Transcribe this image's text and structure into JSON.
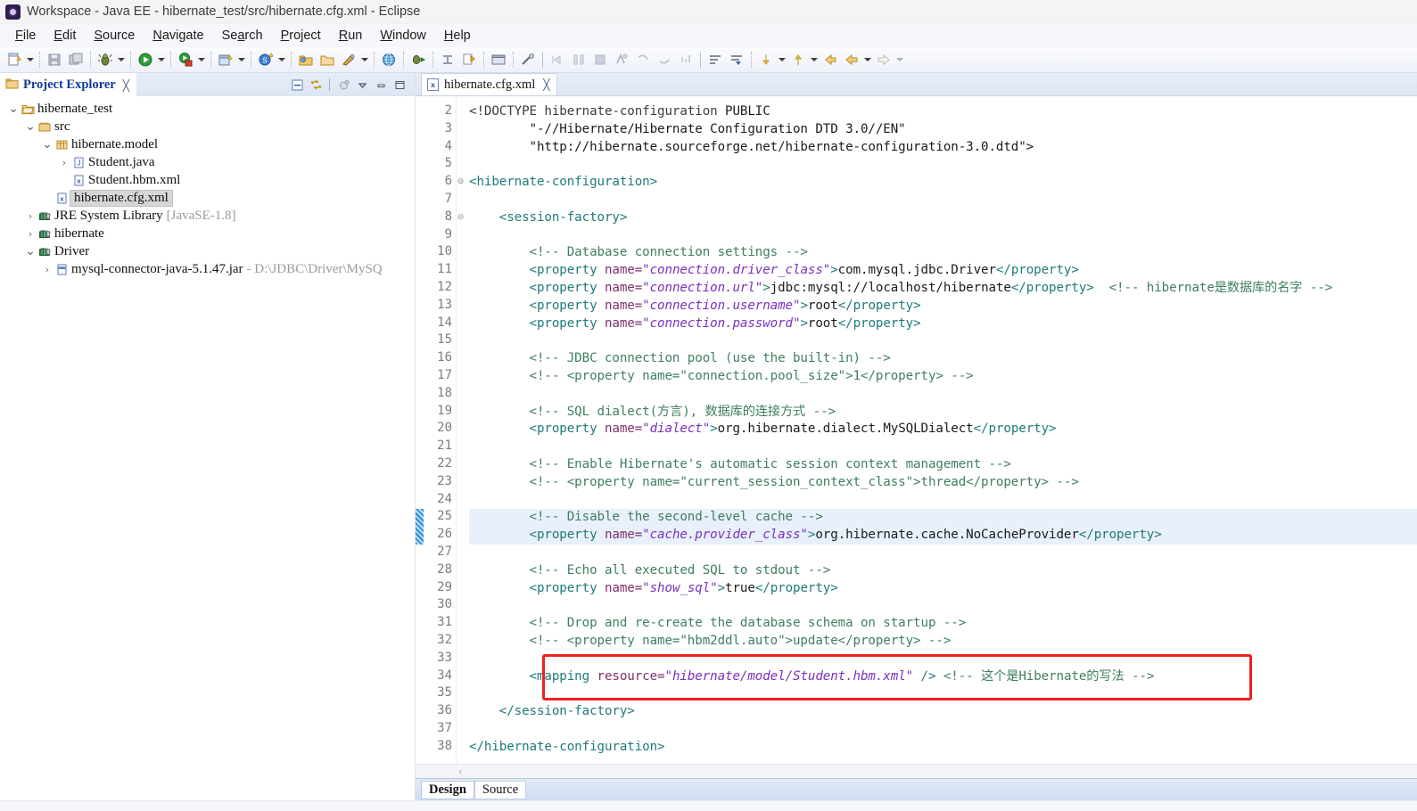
{
  "window": {
    "title": "Workspace - Java EE - hibernate_test/src/hibernate.cfg.xml - Eclipse",
    "app_icon": "eclipse-icon"
  },
  "menubar": {
    "items": [
      {
        "label": "File",
        "mnemonic": "F"
      },
      {
        "label": "Edit",
        "mnemonic": "E"
      },
      {
        "label": "Source",
        "mnemonic": "S"
      },
      {
        "label": "Navigate",
        "mnemonic": "N"
      },
      {
        "label": "Search",
        "mnemonic": "a"
      },
      {
        "label": "Project",
        "mnemonic": "P"
      },
      {
        "label": "Run",
        "mnemonic": "R"
      },
      {
        "label": "Window",
        "mnemonic": "W"
      },
      {
        "label": "Help",
        "mnemonic": "H"
      }
    ]
  },
  "toolbar": {
    "buttons": [
      {
        "name": "new-wizard-icon",
        "tip": "New"
      },
      {
        "name": "save-icon",
        "tip": "Save"
      },
      {
        "name": "save-all-icon",
        "tip": "Save All"
      },
      {
        "name": "debug-icon",
        "tip": "Debug"
      },
      {
        "name": "run-icon",
        "tip": "Run"
      },
      {
        "name": "run-server-icon",
        "tip": "Run on Server"
      },
      {
        "name": "new-java-project-icon",
        "tip": "New Java Project"
      },
      {
        "name": "new-servlet-icon",
        "tip": "New Servlet"
      },
      {
        "name": "open-type-icon",
        "tip": "Open Type"
      },
      {
        "name": "open-task-icon",
        "tip": "Open Task"
      },
      {
        "name": "external-tools-icon",
        "tip": "External Tools"
      },
      {
        "name": "web-browser-icon",
        "tip": "Web Browser"
      },
      {
        "name": "debug-perspective-icon",
        "tip": "Debug Perspective"
      },
      {
        "name": "terminate-icon",
        "tip": "Terminate"
      },
      {
        "name": "relaunch-icon",
        "tip": "Relaunch"
      },
      {
        "name": "console-icon",
        "tip": "Console"
      },
      {
        "name": "skip-breakpoints-icon",
        "tip": "Skip All Breakpoints"
      },
      {
        "name": "step-into-icon",
        "tip": "Step Into"
      },
      {
        "name": "step-over-icon",
        "tip": "Step Over"
      },
      {
        "name": "step-return-icon",
        "tip": "Step Return"
      },
      {
        "name": "drop-to-frame-icon",
        "tip": "Drop to Frame"
      },
      {
        "name": "use-step-filters-icon",
        "tip": "Use Step Filters"
      },
      {
        "name": "next-annotation-icon",
        "tip": "Next Annotation"
      },
      {
        "name": "prev-annotation-icon",
        "tip": "Previous Annotation"
      },
      {
        "name": "last-edit-icon",
        "tip": "Last Edit Location"
      },
      {
        "name": "back-icon",
        "tip": "Back"
      },
      {
        "name": "forward-icon",
        "tip": "Forward"
      }
    ]
  },
  "explorer": {
    "title": "Project Explorer",
    "close_glyph": "╳",
    "tools": [
      {
        "name": "collapse-all-icon"
      },
      {
        "name": "link-with-editor-icon"
      },
      {
        "name": "focus-on-active-task-icon"
      },
      {
        "name": "view-menu-icon"
      },
      {
        "name": "minimize-view-icon"
      },
      {
        "name": "maximize-view-icon"
      }
    ],
    "tree": [
      {
        "indent": 0,
        "twist": "v",
        "icon": "project-icon",
        "label": "hibernate_test",
        "extra": "",
        "selected": false
      },
      {
        "indent": 1,
        "twist": "v",
        "icon": "source-folder-icon",
        "label": "src",
        "extra": "",
        "selected": false
      },
      {
        "indent": 2,
        "twist": "v",
        "icon": "package-icon",
        "label": "hibernate.model",
        "extra": "",
        "selected": false
      },
      {
        "indent": 3,
        "twist": ">",
        "icon": "java-file-icon",
        "label": "Student.java",
        "extra": "",
        "selected": false
      },
      {
        "indent": 3,
        "twist": "",
        "icon": "xml-file-icon",
        "label": "Student.hbm.xml",
        "extra": "",
        "selected": false
      },
      {
        "indent": 2,
        "twist": "",
        "icon": "xml-file-icon",
        "label": "hibernate.cfg.xml",
        "extra": "",
        "selected": true
      },
      {
        "indent": 1,
        "twist": ">",
        "icon": "library-icon",
        "label": "JRE System Library",
        "extra": "[JavaSE-1.8]",
        "selected": false
      },
      {
        "indent": 1,
        "twist": ">",
        "icon": "library-icon",
        "label": "hibernate",
        "extra": "",
        "selected": false
      },
      {
        "indent": 1,
        "twist": "v",
        "icon": "library-icon",
        "label": "Driver",
        "extra": "",
        "selected": false
      },
      {
        "indent": 2,
        "twist": ">",
        "icon": "jar-icon",
        "label": "mysql-connector-java-5.1.47.jar",
        "extra": "- D:\\JDBC\\Driver\\MySQ",
        "selected": false
      }
    ]
  },
  "editor": {
    "tab": {
      "label": "hibernate.cfg.xml",
      "badge": "x",
      "close_glyph": "╳",
      "dirty": false
    },
    "first_line_number": 2,
    "highlighted_lines": [
      25,
      26
    ],
    "change_bar_lines": [
      25,
      26
    ],
    "fold_lines": [
      6,
      8
    ],
    "red_box_line": 34,
    "bottom_tabs": [
      {
        "label": "Design",
        "active": true
      },
      {
        "label": "Source",
        "active": false
      }
    ],
    "lines": [
      {
        "n": 2,
        "indent": 0,
        "parts": [
          {
            "t": "dt",
            "s": "<!DOCTYPE hibernate-configuration "
          },
          {
            "t": "txt",
            "s": "PUBLIC"
          }
        ]
      },
      {
        "n": 3,
        "indent": 0,
        "parts": [
          {
            "t": "txt",
            "s": "        \"-//Hibernate/Hibernate Configuration DTD 3.0//EN\""
          }
        ]
      },
      {
        "n": 4,
        "indent": 0,
        "parts": [
          {
            "t": "txt",
            "s": "        \"http://hibernate.sourceforge.net/hibernate-configuration-3.0.dtd\">"
          }
        ]
      },
      {
        "n": 5,
        "indent": 0,
        "parts": []
      },
      {
        "n": 6,
        "indent": 0,
        "parts": [
          {
            "t": "tg",
            "s": "<hibernate-configuration>"
          }
        ]
      },
      {
        "n": 7,
        "indent": 0,
        "parts": []
      },
      {
        "n": 8,
        "indent": 0,
        "parts": [
          {
            "t": "tg",
            "s": "    <session-factory>"
          }
        ]
      },
      {
        "n": 9,
        "indent": 0,
        "parts": []
      },
      {
        "n": 10,
        "indent": 0,
        "parts": [
          {
            "t": "cm",
            "s": "        <!-- Database connection settings -->"
          }
        ]
      },
      {
        "n": 11,
        "indent": 0,
        "parts": [
          {
            "t": "tg",
            "s": "        <property "
          },
          {
            "t": "at",
            "s": "name="
          },
          {
            "t": "av",
            "s": "\"connection.driver_class\""
          },
          {
            "t": "tg",
            "s": ">"
          },
          {
            "t": "txt",
            "s": "com.mysql.jdbc.Driver"
          },
          {
            "t": "tg",
            "s": "</property>"
          }
        ]
      },
      {
        "n": 12,
        "indent": 0,
        "parts": [
          {
            "t": "tg",
            "s": "        <property "
          },
          {
            "t": "at",
            "s": "name="
          },
          {
            "t": "av",
            "s": "\"connection.url\""
          },
          {
            "t": "tg",
            "s": ">"
          },
          {
            "t": "txt",
            "s": "jdbc:mysql://localhost/hibernate"
          },
          {
            "t": "tg",
            "s": "</property>"
          },
          {
            "t": "cm",
            "s": "  <!-- "
          },
          {
            "t": "cmz",
            "s": "hibernate是数据库的名字"
          },
          {
            "t": "cm",
            "s": " -->"
          }
        ]
      },
      {
        "n": 13,
        "indent": 0,
        "parts": [
          {
            "t": "tg",
            "s": "        <property "
          },
          {
            "t": "at",
            "s": "name="
          },
          {
            "t": "av",
            "s": "\"connection.username\""
          },
          {
            "t": "tg",
            "s": ">"
          },
          {
            "t": "txt",
            "s": "root"
          },
          {
            "t": "tg",
            "s": "</property>"
          }
        ]
      },
      {
        "n": 14,
        "indent": 0,
        "parts": [
          {
            "t": "tg",
            "s": "        <property "
          },
          {
            "t": "at",
            "s": "name="
          },
          {
            "t": "av",
            "s": "\"connection.password\""
          },
          {
            "t": "tg",
            "s": ">"
          },
          {
            "t": "txt",
            "s": "root"
          },
          {
            "t": "tg",
            "s": "</property>"
          }
        ]
      },
      {
        "n": 15,
        "indent": 0,
        "parts": []
      },
      {
        "n": 16,
        "indent": 0,
        "parts": [
          {
            "t": "cm",
            "s": "        <!-- JDBC connection pool (use the built-in) -->"
          }
        ]
      },
      {
        "n": 17,
        "indent": 0,
        "parts": [
          {
            "t": "cm",
            "s": "        <!-- <property name=\"connection.pool_size\">1</property> -->"
          }
        ]
      },
      {
        "n": 18,
        "indent": 0,
        "parts": []
      },
      {
        "n": 19,
        "indent": 0,
        "parts": [
          {
            "t": "cm",
            "s": "        <!-- SQL dialect(方言), 数据库的连接方式 -->"
          }
        ]
      },
      {
        "n": 20,
        "indent": 0,
        "parts": [
          {
            "t": "tg",
            "s": "        <property "
          },
          {
            "t": "at",
            "s": "name="
          },
          {
            "t": "av",
            "s": "\"dialect\""
          },
          {
            "t": "tg",
            "s": ">"
          },
          {
            "t": "txt",
            "s": "org.hibernate.dialect.MySQLDialect"
          },
          {
            "t": "tg",
            "s": "</property>"
          }
        ]
      },
      {
        "n": 21,
        "indent": 0,
        "parts": []
      },
      {
        "n": 22,
        "indent": 0,
        "parts": [
          {
            "t": "cm",
            "s": "        <!-- Enable Hibernate's automatic session context management -->"
          }
        ]
      },
      {
        "n": 23,
        "indent": 0,
        "parts": [
          {
            "t": "cm",
            "s": "        <!-- <property name=\"current_session_context_class\">thread</property> -->"
          }
        ]
      },
      {
        "n": 24,
        "indent": 0,
        "parts": []
      },
      {
        "n": 25,
        "indent": 0,
        "parts": [
          {
            "t": "cm",
            "s": "        <!-- Disable the second-level cache -->"
          }
        ]
      },
      {
        "n": 26,
        "indent": 0,
        "parts": [
          {
            "t": "tg",
            "s": "        <property "
          },
          {
            "t": "at",
            "s": "name="
          },
          {
            "t": "av",
            "s": "\"cache.provider_class\""
          },
          {
            "t": "tg",
            "s": ">"
          },
          {
            "t": "txt",
            "s": "org.hibernate.cache.NoCacheProvider"
          },
          {
            "t": "tg",
            "s": "</property>"
          }
        ]
      },
      {
        "n": 27,
        "indent": 0,
        "parts": []
      },
      {
        "n": 28,
        "indent": 0,
        "parts": [
          {
            "t": "cm",
            "s": "        <!-- Echo all executed SQL to stdout -->"
          }
        ]
      },
      {
        "n": 29,
        "indent": 0,
        "parts": [
          {
            "t": "tg",
            "s": "        <property "
          },
          {
            "t": "at",
            "s": "name="
          },
          {
            "t": "av",
            "s": "\"show_sql\""
          },
          {
            "t": "tg",
            "s": ">"
          },
          {
            "t": "txt",
            "s": "true"
          },
          {
            "t": "tg",
            "s": "</property>"
          }
        ]
      },
      {
        "n": 30,
        "indent": 0,
        "parts": []
      },
      {
        "n": 31,
        "indent": 0,
        "parts": [
          {
            "t": "cm",
            "s": "        <!-- Drop and re-create the database schema on startup -->"
          }
        ]
      },
      {
        "n": 32,
        "indent": 0,
        "parts": [
          {
            "t": "cm",
            "s": "        <!-- <property name=\"hbm2ddl.auto\">update</property> -->"
          }
        ]
      },
      {
        "n": 33,
        "indent": 0,
        "parts": []
      },
      {
        "n": 34,
        "indent": 0,
        "parts": [
          {
            "t": "tg",
            "s": "        <mapping "
          },
          {
            "t": "at",
            "s": "resource="
          },
          {
            "t": "av",
            "s": "\"hibernate/model/Student.hbm.xml\""
          },
          {
            "t": "tg",
            "s": " />"
          },
          {
            "t": "cm",
            "s": " <!-- "
          },
          {
            "t": "cmz",
            "s": "这个是Hibernate的写法"
          },
          {
            "t": "cm",
            "s": " -->"
          }
        ]
      },
      {
        "n": 35,
        "indent": 0,
        "parts": []
      },
      {
        "n": 36,
        "indent": 0,
        "parts": [
          {
            "t": "tg",
            "s": "    </session-factory>"
          }
        ]
      },
      {
        "n": 37,
        "indent": 0,
        "parts": []
      },
      {
        "n": 38,
        "indent": 0,
        "parts": [
          {
            "t": "tg",
            "s": "</hibernate-configuration>"
          }
        ]
      }
    ]
  },
  "colors": {
    "tag": "#1f7a7a",
    "attr_name": "#7f2f6e",
    "attr_value": "#7a2fbf",
    "comment": "#3f7f5f",
    "text": "#1b1b1b",
    "highlight_line": "#e8f0fb",
    "red_box": "#ef2020",
    "selection": "#d6d6d6",
    "tab_title": "#14389c"
  }
}
